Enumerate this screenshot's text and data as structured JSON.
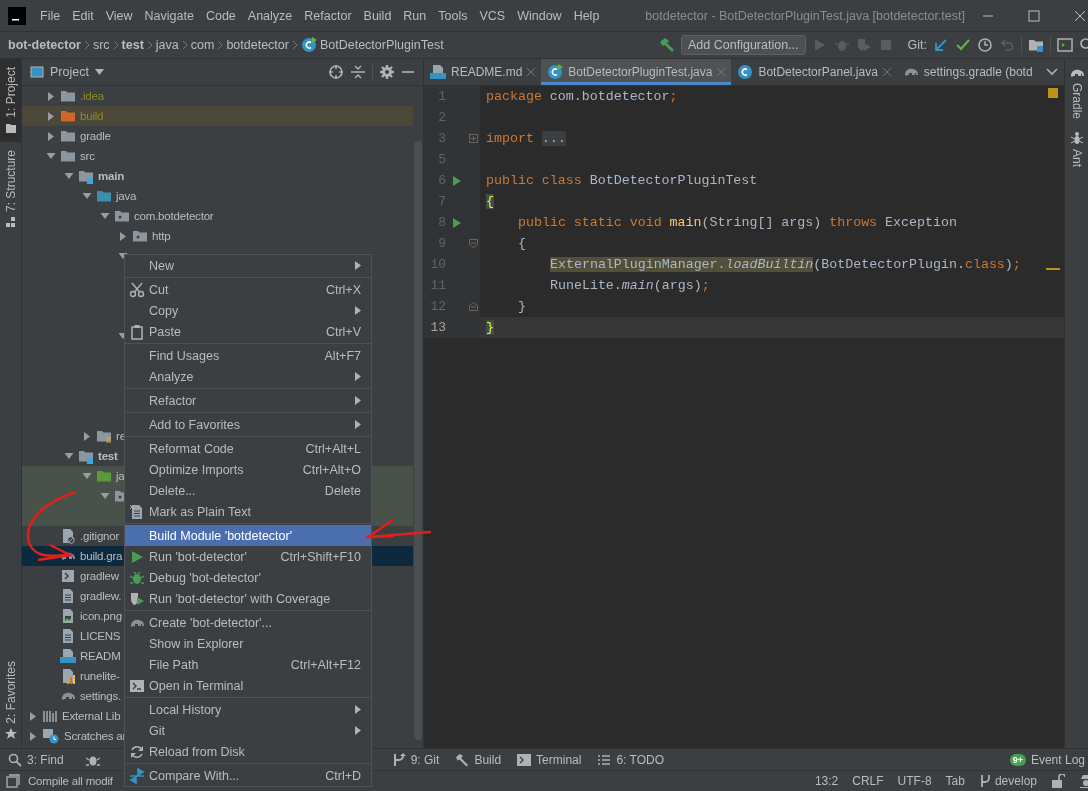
{
  "window": {
    "title": "botdetector - BotDetectorPluginTest.java [botdetector.test]"
  },
  "menu_bar": [
    "File",
    "Edit",
    "View",
    "Navigate",
    "Code",
    "Analyze",
    "Refactor",
    "Build",
    "Run",
    "Tools",
    "VCS",
    "Window",
    "Help"
  ],
  "breadcrumbs": [
    {
      "label": "bot-detector",
      "bold": true
    },
    {
      "label": "src",
      "bold": false
    },
    {
      "label": "test",
      "bold": true
    },
    {
      "label": "java",
      "bold": false
    },
    {
      "label": "com",
      "bold": false
    },
    {
      "label": "botdetector",
      "bold": false
    },
    {
      "label": "BotDetectorPluginTest",
      "bold": false,
      "kind": "class"
    }
  ],
  "toolbar": {
    "run_config": "Add Configuration...",
    "git_label": "Git:"
  },
  "left_stripe": {
    "top": [
      {
        "label": "1: Project",
        "selected": true
      },
      {
        "label": "7: Structure",
        "selected": false
      }
    ],
    "bottom": [
      {
        "label": "2: Favorites",
        "selected": false
      }
    ]
  },
  "project_panel": {
    "title": "Project",
    "items": [
      {
        "label": ".idea",
        "kind": "folder",
        "expanded": false,
        "selected": false,
        "ignored": true
      },
      {
        "label": "build",
        "kind": "folder-excluded",
        "expanded": false,
        "selected": false,
        "ignored": true,
        "excluded": true
      },
      {
        "label": "gradle",
        "kind": "folder",
        "expanded": false,
        "selected": false
      },
      {
        "label": "src",
        "kind": "folder",
        "expanded": true,
        "selected": false,
        "children": [
          {
            "label": "main",
            "kind": "module",
            "expanded": true,
            "selected": false,
            "children": [
              {
                "label": "java",
                "kind": "source",
                "expanded": true,
                "selected": false,
                "children": [
                  {
                    "label": "com.botdetector",
                    "kind": "package",
                    "expanded": true,
                    "selected": false,
                    "children": [
                      {
                        "label": "http",
                        "kind": "package",
                        "expanded": false,
                        "selected": false
                      },
                      {
                        "expanded": true,
                        "selected": false,
                        "children": [
                          {
                            "covered": true
                          },
                          {
                            "covered": true
                          },
                          {
                            "covered": true
                          }
                        ]
                      },
                      {
                        "expanded": true,
                        "selected": false,
                        "children": [
                          {
                            "covered": true
                          },
                          {
                            "covered": true
                          },
                          {
                            "covered": true
                          },
                          {
                            "covered": true
                          }
                        ]
                      }
                    ]
                  }
                ]
              },
              {
                "label": "re",
                "kind": "resources",
                "expanded": false,
                "selected": false
              }
            ]
          },
          {
            "label": "test",
            "kind": "module",
            "expanded": true,
            "selected": false,
            "children": [
              {
                "label": "ja",
                "kind": "test-source",
                "expanded": true,
                "selected": false,
                "test_scope": true,
                "children": [
                  {
                    "kind": "package",
                    "expanded": true,
                    "selected": false,
                    "test_scope": true,
                    "children": [
                      {
                        "covered": true,
                        "test_scope": true
                      }
                    ]
                  }
                ]
              }
            ]
          }
        ]
      },
      {
        "label": ".gitignor",
        "kind": "ignore-file",
        "selected": false
      },
      {
        "label": "build.gra",
        "kind": "gradle",
        "selected": true
      },
      {
        "label": "gradlew",
        "kind": "script-file",
        "selected": false
      },
      {
        "label": "gradlew.",
        "kind": "text-file",
        "selected": false
      },
      {
        "label": "icon.png",
        "kind": "image-file",
        "selected": false
      },
      {
        "label": "LICENS",
        "kind": "text-file",
        "selected": false
      },
      {
        "label": "READM",
        "kind": "md-file",
        "selected": false
      },
      {
        "label": "runelite-",
        "kind": "chart-file",
        "selected": false
      },
      {
        "label": "settings.",
        "kind": "gradle",
        "selected": false
      }
    ],
    "roots": [
      {
        "label": "External Lib",
        "kind": "libraries",
        "expanded": false,
        "selected": false
      },
      {
        "label": "Scratches ar",
        "kind": "scratches",
        "expanded": false,
        "selected": false
      }
    ]
  },
  "context_menu": {
    "groups": [
      [
        {
          "label": "New",
          "submenu": true,
          "selected": false
        }
      ],
      [
        {
          "label": "Cut",
          "shortcut": "Ctrl+X",
          "kind": "cut",
          "selected": false
        },
        {
          "label": "Copy",
          "submenu": true,
          "selected": false
        },
        {
          "label": "Paste",
          "shortcut": "Ctrl+V",
          "kind": "paste",
          "selected": false
        }
      ],
      [
        {
          "label": "Find Usages",
          "shortcut": "Alt+F7",
          "selected": false
        },
        {
          "label": "Analyze",
          "submenu": true,
          "selected": false
        }
      ],
      [
        {
          "label": "Refactor",
          "submenu": true,
          "selected": false
        }
      ],
      [
        {
          "label": "Add to Favorites",
          "submenu": true,
          "selected": false
        }
      ],
      [
        {
          "label": "Reformat Code",
          "shortcut": "Ctrl+Alt+L",
          "selected": false
        },
        {
          "label": "Optimize Imports",
          "shortcut": "Ctrl+Alt+O",
          "selected": false
        },
        {
          "label": "Delete...",
          "shortcut": "Delete",
          "selected": false
        },
        {
          "label": "Mark as Plain Text",
          "kind": "plain-text",
          "selected": false
        }
      ],
      [
        {
          "label": "Build Module 'botdetector'",
          "selected": true
        },
        {
          "label": "Run 'bot-detector'",
          "shortcut": "Ctrl+Shift+F10",
          "kind": "run",
          "selected": false
        },
        {
          "label": "Debug 'bot-detector'",
          "kind": "debug",
          "selected": false
        },
        {
          "label": "Run 'bot-detector' with Coverage",
          "kind": "coverage",
          "selected": false
        }
      ],
      [
        {
          "label": "Create 'bot-detector'...",
          "kind": "gradle",
          "selected": false
        },
        {
          "label": "Show in Explorer",
          "selected": false
        },
        {
          "label": "File Path",
          "shortcut": "Ctrl+Alt+F12",
          "selected": false
        },
        {
          "label": "Open in Terminal",
          "kind": "terminal",
          "selected": false
        }
      ],
      [
        {
          "label": "Local History",
          "submenu": true,
          "selected": false
        },
        {
          "label": "Git",
          "submenu": true,
          "selected": false
        },
        {
          "label": "Reload from Disk",
          "kind": "reload",
          "selected": false
        }
      ],
      [
        {
          "label": "Compare With...",
          "shortcut": "Ctrl+D",
          "kind": "compare",
          "selected": false
        }
      ]
    ]
  },
  "editor": {
    "tabs": [
      {
        "label": "README.md",
        "kind": "md",
        "selected": false,
        "closable": true
      },
      {
        "label": "BotDetectorPluginTest.java",
        "kind": "class-run",
        "selected": true,
        "closable": true
      },
      {
        "label": "BotDetectorPanel.java",
        "kind": "class",
        "selected": false,
        "closable": true
      },
      {
        "label": "settings.gradle (botd",
        "kind": "gradle",
        "selected": false,
        "closable": false
      }
    ],
    "lines": [
      {
        "number": "1",
        "current": false,
        "tokens": [
          {
            "kind": "kw",
            "text": "package"
          },
          {
            "kind": "plain",
            "text": " com.botdetector"
          },
          {
            "kind": "kw",
            "text": ";"
          }
        ]
      },
      {
        "number": "2",
        "current": false
      },
      {
        "number": "3",
        "current": false,
        "folded": true,
        "tokens": [
          {
            "kind": "kw",
            "text": "import "
          },
          {
            "kind": "folded",
            "text": "..."
          }
        ]
      },
      {
        "number": "5",
        "current": false
      },
      {
        "number": "6",
        "current": false,
        "run_marker": true,
        "tokens": [
          {
            "kind": "kw",
            "text": "public class"
          },
          {
            "kind": "plain",
            "text": " BotDetectorPluginTest"
          }
        ]
      },
      {
        "number": "7",
        "current": false,
        "tokens": [
          {
            "kind": "brace",
            "text": "{"
          }
        ]
      },
      {
        "number": "8",
        "current": false,
        "run_marker": true,
        "kind": "member",
        "tokens": [
          {
            "kind": "kw",
            "text": "public static void"
          },
          {
            "kind": "fn",
            "text": " main"
          },
          {
            "kind": "plain",
            "text": "(String[] args) "
          },
          {
            "kind": "kw",
            "text": "throws"
          },
          {
            "kind": "plain",
            "text": " Exception"
          }
        ]
      },
      {
        "number": "9",
        "current": false,
        "fold_start": true,
        "kind": "member",
        "tokens": [
          {
            "kind": "plain",
            "text": "{"
          }
        ]
      },
      {
        "number": "10",
        "current": false,
        "kind": "statement",
        "tokens": [
          {
            "kind": "usage",
            "text": "ExternalPluginManager."
          },
          {
            "kind": "usage-static",
            "text": "loadBuiltin"
          },
          {
            "kind": "plain",
            "text": "(BotDetectorPlugin."
          },
          {
            "kind": "kw",
            "text": "class"
          },
          {
            "kind": "plain",
            "text": ")"
          },
          {
            "kind": "kw",
            "text": ";"
          }
        ]
      },
      {
        "number": "11",
        "current": false,
        "kind": "statement",
        "tokens": [
          {
            "kind": "plain",
            "text": "RuneLite."
          },
          {
            "kind": "static",
            "text": "main"
          },
          {
            "kind": "plain",
            "text": "(args)"
          },
          {
            "kind": "kw",
            "text": ";"
          }
        ]
      },
      {
        "number": "12",
        "current": false,
        "fold_end": true,
        "kind": "member",
        "tokens": [
          {
            "kind": "plain",
            "text": "}"
          }
        ]
      },
      {
        "number": "13",
        "current": true,
        "tokens": [
          {
            "kind": "brace",
            "text": "}"
          }
        ]
      }
    ]
  },
  "right_stripe": [
    {
      "label": "Gradle",
      "kind": "gradle"
    },
    {
      "label": "Ant",
      "kind": "ant"
    }
  ],
  "tool_windows": {
    "left": [
      {
        "label": "3: Find",
        "kind": "find"
      },
      {
        "kind": "debug"
      }
    ],
    "right": [
      {
        "label": "9: Git",
        "kind": "git"
      },
      {
        "label": "Build",
        "kind": "build"
      },
      {
        "label": "Terminal",
        "kind": "terminal"
      },
      {
        "label": "6: TODO",
        "kind": "todo"
      }
    ],
    "event_log": {
      "label": "Event Log",
      "badge": "9+"
    }
  },
  "status_bar": {
    "message": "Compile all modif",
    "position": "13:2",
    "line_separator": "CRLF",
    "encoding": "UTF-8",
    "indent": "Tab",
    "branch": "develop"
  },
  "annotations": [
    {
      "kind": "curved-arrow"
    },
    {
      "kind": "arrow"
    }
  ]
}
